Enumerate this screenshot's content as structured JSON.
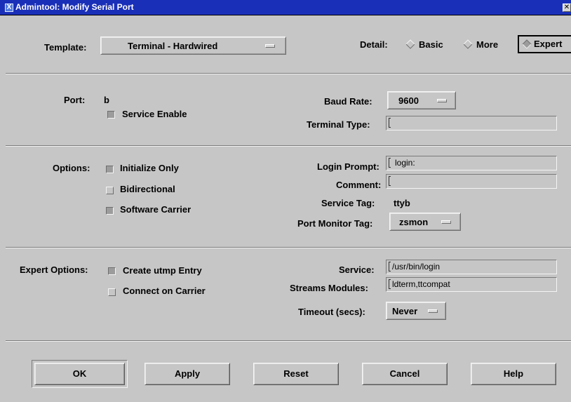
{
  "window": {
    "icon_glyph": "X",
    "title": "Admintool: Modify Serial Port",
    "close_glyph": "✕"
  },
  "template": {
    "label": "Template:",
    "value": "Terminal - Hardwired"
  },
  "detail": {
    "label": "Detail:",
    "options": [
      "Basic",
      "More",
      "Expert"
    ],
    "selected": "Expert"
  },
  "port": {
    "label": "Port:",
    "value": "b",
    "service_enable": {
      "label": "Service Enable",
      "checked": true
    },
    "baud_rate": {
      "label": "Baud Rate:",
      "value": "9600"
    },
    "terminal_type": {
      "label": "Terminal Type:",
      "value": ""
    }
  },
  "options": {
    "label": "Options:",
    "initialize_only": {
      "label": "Initialize Only",
      "checked": true
    },
    "bidirectional": {
      "label": "Bidirectional",
      "checked": false
    },
    "software_carrier": {
      "label": "Software Carrier",
      "checked": true
    },
    "login_prompt": {
      "label": "Login Prompt:",
      "value": "login:"
    },
    "comment": {
      "label": "Comment:",
      "value": ""
    },
    "service_tag": {
      "label": "Service Tag:",
      "value": "ttyb"
    },
    "port_monitor_tag": {
      "label": "Port Monitor Tag:",
      "value": "zsmon"
    }
  },
  "expert": {
    "label": "Expert Options:",
    "create_utmp": {
      "label": "Create utmp Entry",
      "checked": true
    },
    "connect_on_carrier": {
      "label": "Connect on Carrier",
      "checked": false
    },
    "service": {
      "label": "Service:",
      "value": "/usr/bin/login"
    },
    "streams_modules": {
      "label": "Streams Modules:",
      "value": "ldterm,ttcompat"
    },
    "timeout": {
      "label": "Timeout (secs):",
      "value": "Never"
    }
  },
  "buttons": {
    "ok": "OK",
    "apply": "Apply",
    "reset": "Reset",
    "cancel": "Cancel",
    "help": "Help"
  },
  "colors": {
    "titlebar": "#1a2fb8",
    "background": "#c6c6c6"
  }
}
